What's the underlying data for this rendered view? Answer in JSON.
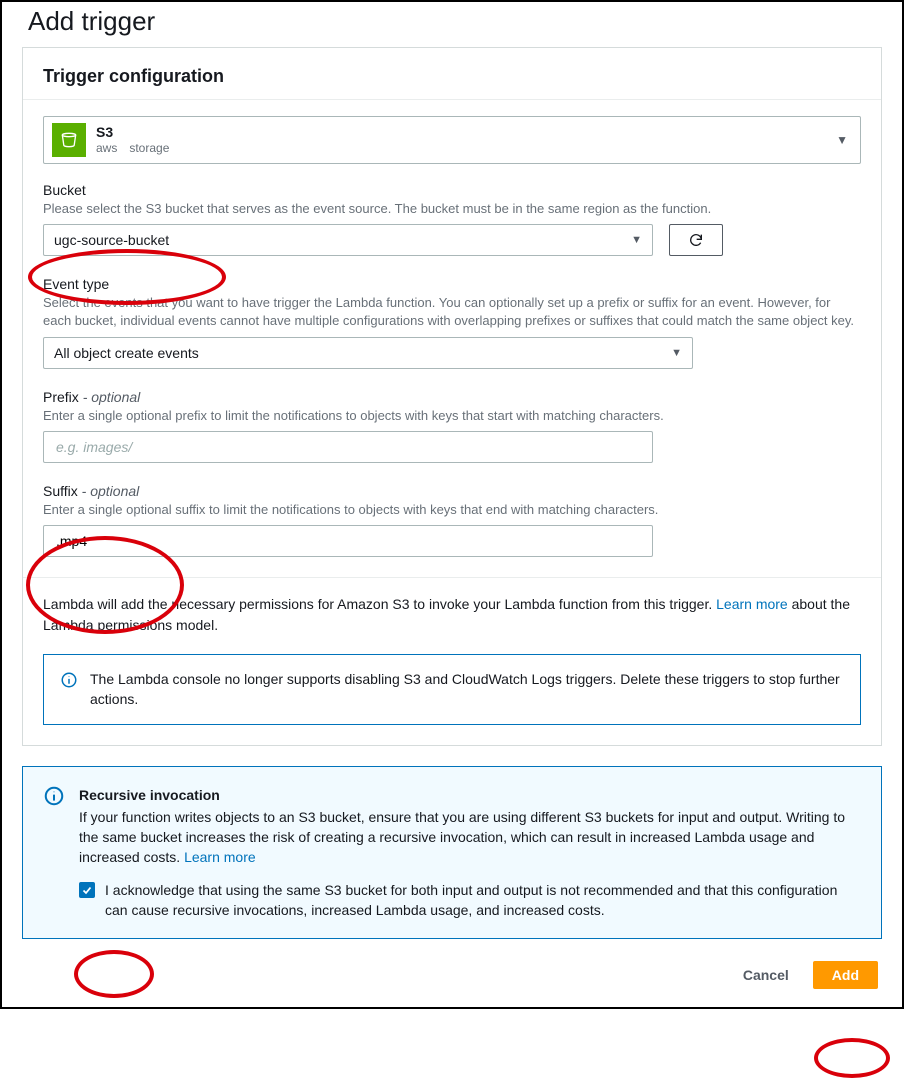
{
  "page": {
    "title": "Add trigger"
  },
  "config": {
    "heading": "Trigger configuration",
    "source": {
      "title": "S3",
      "tag1": "aws",
      "tag2": "storage"
    },
    "bucket": {
      "label": "Bucket",
      "desc": "Please select the S3 bucket that serves as the event source. The bucket must be in the same region as the function.",
      "value": "ugc-source-bucket"
    },
    "event_type": {
      "label": "Event type",
      "desc": "Select the events that you want to have trigger the Lambda function. You can optionally set up a prefix or suffix for an event. However, for each bucket, individual events cannot have multiple configurations with overlapping prefixes or suffixes that could match the same object key.",
      "value": "All object create events"
    },
    "prefix": {
      "label": "Prefix",
      "optional": "- optional",
      "desc": "Enter a single optional prefix to limit the notifications to objects with keys that start with matching characters.",
      "placeholder": "e.g. images/",
      "value": ""
    },
    "suffix": {
      "label": "Suffix",
      "optional": "- optional",
      "desc": "Enter a single optional suffix to limit the notifications to objects with keys that end with matching characters.",
      "value": ".mp4"
    },
    "permissions": {
      "text_before": "Lambda will add the necessary permissions for Amazon S3 to invoke your Lambda function from this trigger. ",
      "link": "Learn more",
      "text_after": " about the Lambda permissions model."
    },
    "alert": {
      "text": "The Lambda console no longer supports disabling S3 and CloudWatch Logs triggers. Delete these triggers to stop further actions."
    }
  },
  "recursive": {
    "title": "Recursive invocation",
    "body_before": "If your function writes objects to an S3 bucket, ensure that you are using different S3 buckets for input and output. Writing to the same bucket increases the risk of creating a recursive invocation, which can result in increased Lambda usage and increased costs. ",
    "link": "Learn more",
    "ack": "I acknowledge that using the same S3 bucket for both input and output is not recommended and that this configuration can cause recursive invocations, increased Lambda usage, and increased costs.",
    "checked": true
  },
  "footer": {
    "cancel": "Cancel",
    "add": "Add"
  }
}
